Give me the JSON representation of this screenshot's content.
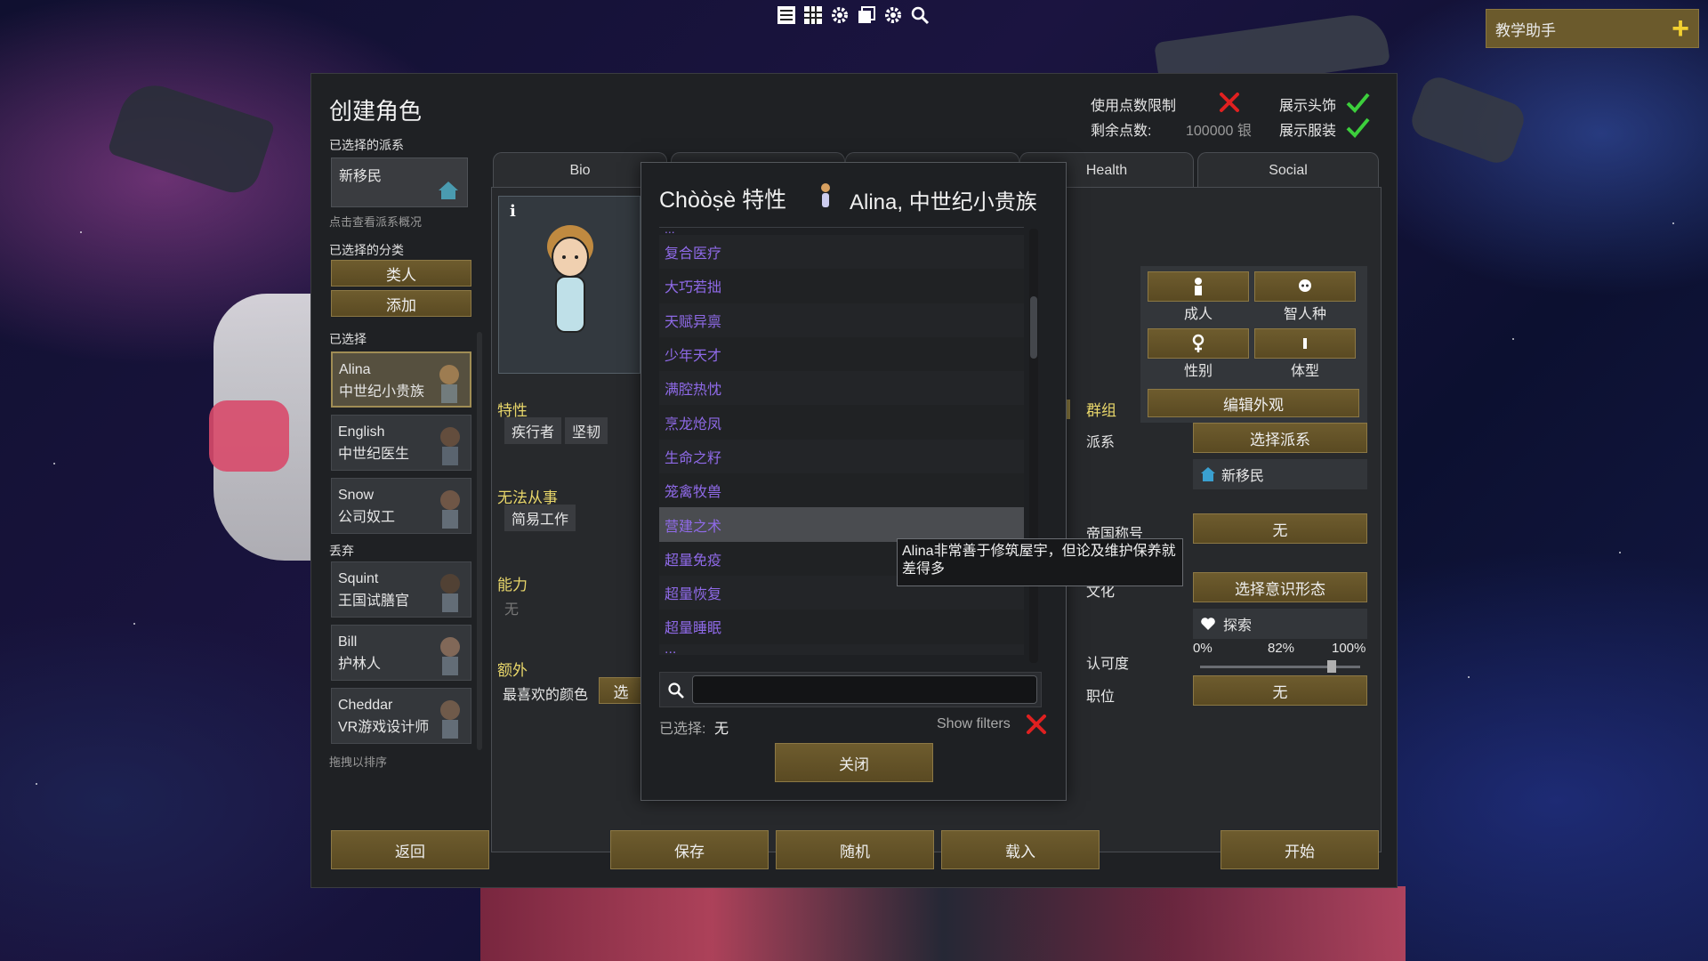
{
  "toolbar": {
    "icons": [
      "menu-list-icon",
      "grid-icon",
      "gear-icon",
      "stack-icon",
      "gear-icon",
      "search-icon"
    ]
  },
  "tutor": {
    "label": "教学助手"
  },
  "window": {
    "title": "创建角色",
    "faction_section": "已选择的派系",
    "faction_name": "新移民",
    "faction_hint": "点击查看派系概况",
    "category_section": "已选择的分类",
    "category_button": "类人",
    "add_button": "添加",
    "selected_section": "已选择",
    "discard_section": "丢弃",
    "drag_hint": "拖拽以排序",
    "selected_pawns": [
      {
        "name": "Alina",
        "title": "中世纪小贵族"
      },
      {
        "name": "English",
        "title": "中世纪医生"
      },
      {
        "name": "Snow",
        "title": "公司奴工"
      }
    ],
    "discarded_pawns": [
      {
        "name": "Squint",
        "title": "王国试膳官"
      },
      {
        "name": "Bill",
        "title": "护林人"
      },
      {
        "name": "Cheddar",
        "title": "VR游戏设计师"
      }
    ],
    "point_limit_label": "使用点数限制",
    "points_left_label": "剩余点数:",
    "points_left_value": "100000 银",
    "show_headgear_label": "展示头饰",
    "show_apparel_label": "展示服装",
    "tabs": [
      "Bio",
      "",
      "",
      "Health",
      "Social"
    ],
    "info_icon": "i",
    "traits_label": "特性",
    "traits": [
      "疾行者",
      "坚韧"
    ],
    "incapable_label": "无法从事",
    "incapable": [
      "简易工作"
    ],
    "abilities_label": "能力",
    "abilities_value": "无",
    "extra_label": "额外",
    "favorite_color_label": "最喜欢的颜色",
    "favorite_color_btn": "选",
    "appearance": {
      "adult": "成人",
      "species": "智人种",
      "gender": "性别",
      "body": "体型",
      "edit": "编辑外观"
    },
    "group_label": "群组",
    "faction_label": "派系",
    "choose_faction_btn": "选择派系",
    "faction_value": "新移民",
    "title_label": "帝国称号",
    "title_value": "无",
    "culture_label": "文化",
    "choose_ideo_btn": "选择意识形态",
    "ideo_value": "探索",
    "certainty_label": "认可度",
    "certainty": {
      "min": "0%",
      "current": "82%",
      "max": "100%",
      "value": 0.82
    },
    "role_label": "职位",
    "role_value": "无",
    "bottom": {
      "back": "返回",
      "save": "保存",
      "random": "随机",
      "load": "载入",
      "start": "开始"
    },
    "colors": {
      "gold_button": "#6b5a2c",
      "trait_purple": "#8f6ae8",
      "section_yellow": "#e8d66a",
      "cross_red": "#e02020",
      "check_green": "#3ccf3c"
    }
  },
  "dialog": {
    "title": "Chòòṣè 特性",
    "pawn_name": "Alina, 中世纪小贵族",
    "partial_top": "...",
    "traits": [
      "复合医疗",
      "大巧若拙",
      "天赋异禀",
      "少年天才",
      "满腔热忱",
      "烹龙炝凤",
      "生命之籽",
      "笼禽牧兽",
      "营建之术",
      "超量免疫",
      "超量恢复",
      "超量睡眠"
    ],
    "partial_bottom": "...",
    "hovered_trait": "营建之术",
    "search_placeholder": "",
    "selected_label": "已选择:",
    "selected_value": "无",
    "show_filters_label": "Show filters",
    "close_button": "关闭",
    "tooltip": "Alina非常善于修筑屋宇，但论及维护保养就差得多"
  }
}
